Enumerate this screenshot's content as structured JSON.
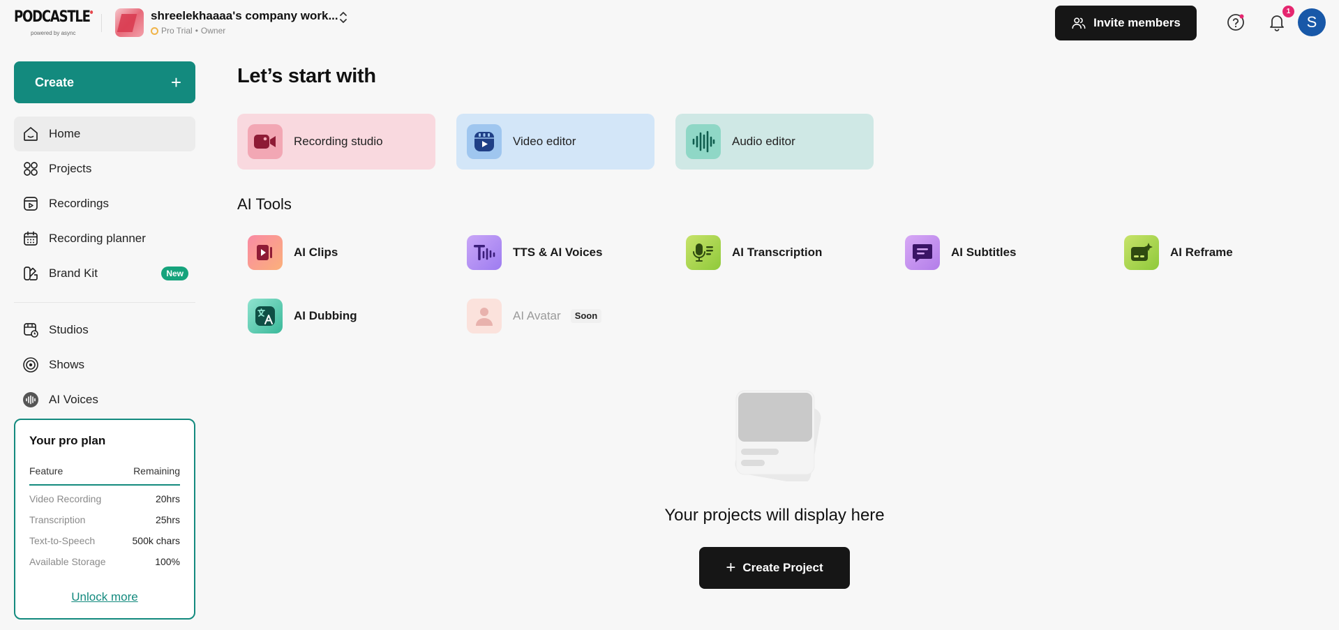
{
  "header": {
    "logo": "PODCASTLE",
    "logo_sub": "powered by async",
    "workspace_name": "shreelekhaaaa's company work...",
    "plan": "Pro Trial",
    "role": "Owner",
    "separator": "•",
    "invite_label": "Invite members",
    "notification_count": "1",
    "avatar_initial": "S"
  },
  "sidebar": {
    "create_label": "Create",
    "create_plus": "+",
    "nav": [
      {
        "label": "Home",
        "icon": "home-icon",
        "active": true
      },
      {
        "label": "Projects",
        "icon": "grid-icon"
      },
      {
        "label": "Recordings",
        "icon": "recordings-icon"
      },
      {
        "label": "Recording planner",
        "icon": "calendar-icon"
      },
      {
        "label": "Brand Kit",
        "icon": "brand-kit-icon",
        "badge": "New"
      },
      {
        "label": "Studios",
        "icon": "studio-icon"
      },
      {
        "label": "Shows",
        "icon": "podcast-icon"
      },
      {
        "label": "AI Voices",
        "icon": "waveform-icon"
      }
    ],
    "plan_card": {
      "title": "Your pro plan",
      "col_feature": "Feature",
      "col_remaining": "Remaining",
      "rows": [
        {
          "feature": "Video Recording",
          "remaining": "20hrs"
        },
        {
          "feature": "Transcription",
          "remaining": "25hrs"
        },
        {
          "feature": "Text-to-Speech",
          "remaining": "500k chars"
        },
        {
          "feature": "Available Storage",
          "remaining": "100%"
        }
      ],
      "unlock_label": "Unlock more"
    }
  },
  "main": {
    "heading": "Let’s start with",
    "start_cards": [
      {
        "label": "Recording studio",
        "bg": "#f9d9df",
        "icon_bg": "#f2a7b4",
        "icon": "video-camera-icon"
      },
      {
        "label": "Video editor",
        "bg": "#d3e6f8",
        "icon_bg": "#9fc6ef",
        "icon": "video-editor-icon"
      },
      {
        "label": "Audio editor",
        "bg": "#cfe8e5",
        "icon_bg": "#8fd7c6",
        "icon": "audio-wave-icon"
      }
    ],
    "ai_heading": "AI Tools",
    "tools": [
      {
        "label": "AI Clips",
        "icon": "clips-icon"
      },
      {
        "label": "TTS & AI Voices",
        "icon": "tts-icon"
      },
      {
        "label": "AI Transcription",
        "icon": "transcription-icon"
      },
      {
        "label": "AI Subtitles",
        "icon": "subtitles-icon"
      },
      {
        "label": "AI Reframe",
        "icon": "reframe-icon"
      },
      {
        "label": "AI Dubbing",
        "icon": "dubbing-icon"
      },
      {
        "label": "AI Avatar",
        "icon": "avatar-person-icon",
        "badge": "Soon"
      }
    ],
    "empty_text": "Your projects will display here",
    "create_project_label": "Create Project",
    "create_project_plus": "+"
  },
  "colors": {
    "brand_teal": "#138a7e",
    "dark_button": "#161616",
    "avatar_blue": "#1858a8",
    "badge_pink": "#e5266f"
  }
}
